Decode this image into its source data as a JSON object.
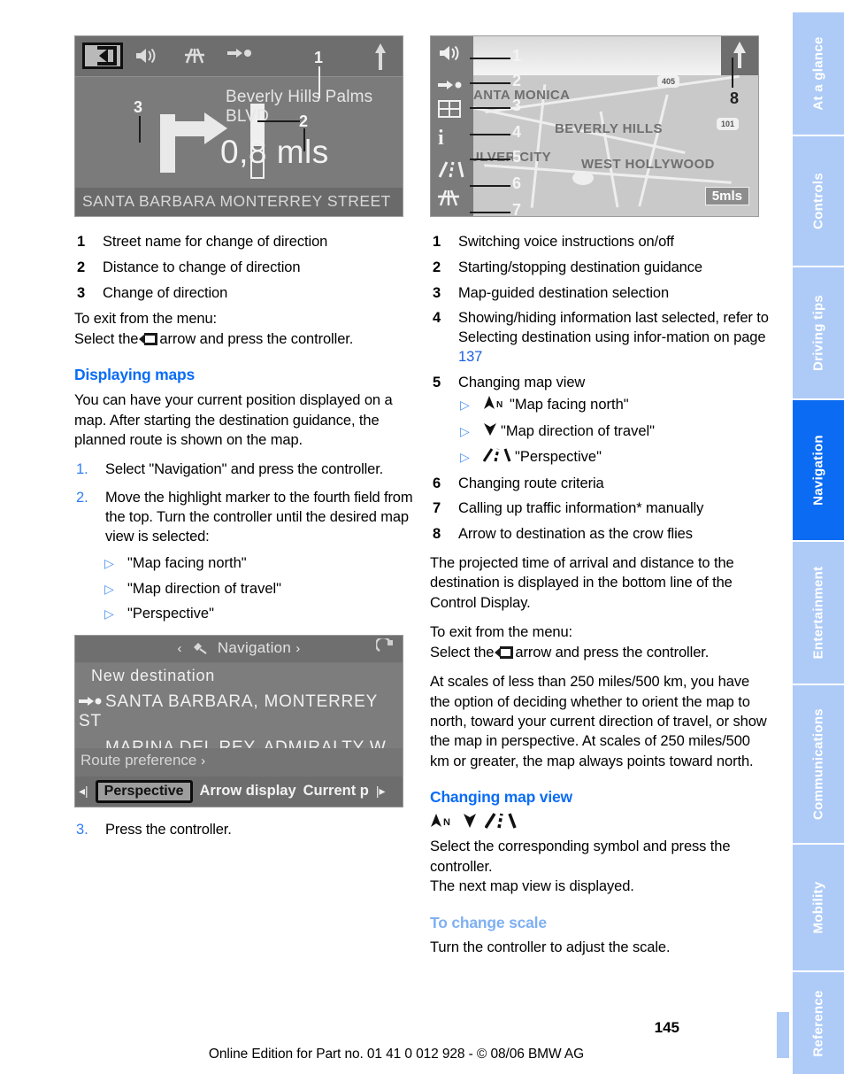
{
  "page": {
    "number": "145",
    "footer_line": "Online Edition for Part no. 01 41 0 012 928 - © 08/06 BMW AG",
    "accent_blue": "#0a6cf5",
    "accent_light_blue": "#7fb0f2",
    "tab_inactive": "#aecbf7",
    "tab_active": "#0b6bf3"
  },
  "tabs": [
    {
      "label": "At a glance",
      "active": false
    },
    {
      "label": "Controls",
      "active": false
    },
    {
      "label": "Driving tips",
      "active": false
    },
    {
      "label": "Navigation",
      "active": true
    },
    {
      "label": "Entertainment",
      "active": false
    },
    {
      "label": "Communications",
      "active": false
    },
    {
      "label": "Mobility",
      "active": false
    },
    {
      "label": "Reference",
      "active": false
    }
  ],
  "figure_arrow_view": {
    "name": "arrow-view-screenshot",
    "street_name": "Beverly Hills Palms BLVD",
    "distance": "0,8 mls",
    "current_street": "SANTA BARBARA MONTERREY STREET",
    "callouts": [
      "1",
      "2",
      "3"
    ]
  },
  "figure_map_view": {
    "name": "map-view-screenshot",
    "scale_label": "5mls",
    "map_labels": [
      "ANTA MONICA",
      "BEVERLY HILLS",
      "WEST HOLLYWOOD",
      "ULVER CITY"
    ],
    "shields": [
      "405",
      "101"
    ],
    "callouts": [
      "1",
      "2",
      "3",
      "4",
      "5",
      "6",
      "7",
      "8"
    ]
  },
  "figure_nav_menu": {
    "name": "navigation-menu-screenshot",
    "title": "Navigation",
    "items": [
      "New destination",
      "SANTA BARBARA, MONTERREY ST",
      "MARINA DEL REY, ADMIRALTY W"
    ],
    "route_preference": "Route preference",
    "bottom_options": [
      "Perspective",
      "Arrow display",
      "Current p"
    ],
    "selected_option": "Perspective"
  },
  "left_column": {
    "legend": [
      {
        "num": "1",
        "text": "Street name for change of direction"
      },
      {
        "num": "2",
        "text": "Distance to change of direction"
      },
      {
        "num": "3",
        "text": "Change of direction"
      }
    ],
    "exit_menu_line1": "To exit from the menu:",
    "exit_menu_prefix": "Select the",
    "exit_menu_suffix": "arrow and press the controller.",
    "heading_displaying_maps": "Displaying maps",
    "intro": "You can have your current position displayed on a map. After starting the destination guidance, the planned route is shown on the map.",
    "steps": [
      {
        "num": "1.",
        "text": "Select \"Navigation\" and press the controller."
      },
      {
        "num": "2.",
        "text": "Move the highlight marker to the fourth field from the top. Turn the controller until the desired map view is selected:"
      }
    ],
    "map_view_options": [
      "\"Map facing north\"",
      "\"Map direction of travel\"",
      "\"Perspective\""
    ],
    "step3": {
      "num": "3.",
      "text": "Press the controller."
    }
  },
  "right_column": {
    "legend": [
      {
        "num": "1",
        "text": "Switching voice instructions on/off"
      },
      {
        "num": "2",
        "text": "Starting/stopping destination guidance"
      },
      {
        "num": "3",
        "text": "Map-guided destination selection"
      },
      {
        "num": "4",
        "text": "Showing/hiding information last selected, refer to Selecting destination using infor-mation on page "
      },
      {
        "num": "5",
        "text": "Changing map view"
      },
      {
        "num": "6",
        "text": "Changing route criteria"
      },
      {
        "num": "7",
        "text": "Calling up traffic information* manually"
      },
      {
        "num": "8",
        "text": "Arrow to destination as the crow flies"
      }
    ],
    "legend4_page_ref": "137",
    "map_view_options": [
      "\"Map facing north\"",
      "\"Map direction of travel\"",
      "\"Perspective\""
    ],
    "eta_paragraph": "The projected time of arrival and distance to the destination is displayed in the bottom line of the Control Display.",
    "exit_menu_line1": "To exit from the menu:",
    "exit_menu_prefix": "Select the",
    "exit_menu_suffix": "arrow and press the controller.",
    "scales_paragraph": "At scales of less than 250 miles/500 km, you have the option of deciding whether to orient the map to north, toward your current direction of travel, or show the map in perspective. At scales of 250 miles/500 km or greater, the map always points toward north.",
    "heading_changing_map_view": "Changing map view",
    "changing_map_view_body1": "Select the corresponding symbol and press the controller.",
    "changing_map_view_body2": "The next map view is displayed.",
    "subheading_to_change_scale": "To change scale",
    "to_change_scale_body": "Turn the controller to adjust the scale."
  }
}
